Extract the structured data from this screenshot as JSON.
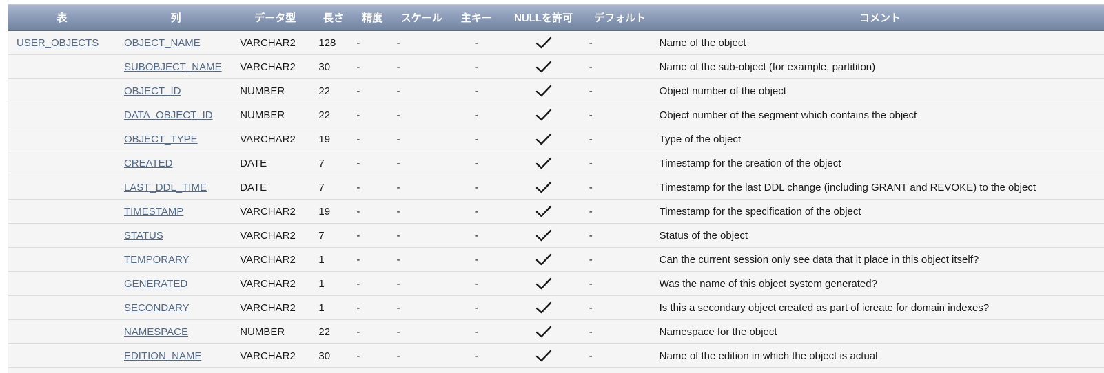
{
  "headers": {
    "table": "表",
    "column": "列",
    "data_type": "データ型",
    "length": "長さ",
    "precision": "精度",
    "scale": "スケール",
    "primary_key": "主キー",
    "nullable": "NULLを許可",
    "default": "デフォルト",
    "comment": "コメント"
  },
  "table_name": "USER_OBJECTS",
  "rows": [
    {
      "column": "OBJECT_NAME",
      "type": "VARCHAR2",
      "length": "128",
      "precision": "-",
      "scale": "-",
      "pk": "-",
      "nullable": true,
      "default": "-",
      "comment": "Name of the object"
    },
    {
      "column": "SUBOBJECT_NAME",
      "type": "VARCHAR2",
      "length": "30",
      "precision": "-",
      "scale": "-",
      "pk": "-",
      "nullable": true,
      "default": "-",
      "comment": "Name of the sub-object (for example, partititon)"
    },
    {
      "column": "OBJECT_ID",
      "type": "NUMBER",
      "length": "22",
      "precision": "-",
      "scale": "-",
      "pk": "-",
      "nullable": true,
      "default": "-",
      "comment": "Object number of the object"
    },
    {
      "column": "DATA_OBJECT_ID",
      "type": "NUMBER",
      "length": "22",
      "precision": "-",
      "scale": "-",
      "pk": "-",
      "nullable": true,
      "default": "-",
      "comment": "Object number of the segment which contains the object"
    },
    {
      "column": "OBJECT_TYPE",
      "type": "VARCHAR2",
      "length": "19",
      "precision": "-",
      "scale": "-",
      "pk": "-",
      "nullable": true,
      "default": "-",
      "comment": "Type of the object"
    },
    {
      "column": "CREATED",
      "type": "DATE",
      "length": "7",
      "precision": "-",
      "scale": "-",
      "pk": "-",
      "nullable": true,
      "default": "-",
      "comment": "Timestamp for the creation of the object"
    },
    {
      "column": "LAST_DDL_TIME",
      "type": "DATE",
      "length": "7",
      "precision": "-",
      "scale": "-",
      "pk": "-",
      "nullable": true,
      "default": "-",
      "comment": "Timestamp for the last DDL change (including GRANT and REVOKE) to the object"
    },
    {
      "column": "TIMESTAMP",
      "type": "VARCHAR2",
      "length": "19",
      "precision": "-",
      "scale": "-",
      "pk": "-",
      "nullable": true,
      "default": "-",
      "comment": "Timestamp for the specification of the object"
    },
    {
      "column": "STATUS",
      "type": "VARCHAR2",
      "length": "7",
      "precision": "-",
      "scale": "-",
      "pk": "-",
      "nullable": true,
      "default": "-",
      "comment": "Status of the object"
    },
    {
      "column": "TEMPORARY",
      "type": "VARCHAR2",
      "length": "1",
      "precision": "-",
      "scale": "-",
      "pk": "-",
      "nullable": true,
      "default": "-",
      "comment": "Can the current session only see data that it place in this object itself?"
    },
    {
      "column": "GENERATED",
      "type": "VARCHAR2",
      "length": "1",
      "precision": "-",
      "scale": "-",
      "pk": "-",
      "nullable": true,
      "default": "-",
      "comment": "Was the name of this object system generated?"
    },
    {
      "column": "SECONDARY",
      "type": "VARCHAR2",
      "length": "1",
      "precision": "-",
      "scale": "-",
      "pk": "-",
      "nullable": true,
      "default": "-",
      "comment": "Is this a secondary object created as part of icreate for domain indexes?"
    },
    {
      "column": "NAMESPACE",
      "type": "NUMBER",
      "length": "22",
      "precision": "-",
      "scale": "-",
      "pk": "-",
      "nullable": true,
      "default": "-",
      "comment": "Namespace for the object"
    },
    {
      "column": "EDITION_NAME",
      "type": "VARCHAR2",
      "length": "30",
      "precision": "-",
      "scale": "-",
      "pk": "-",
      "nullable": true,
      "default": "-",
      "comment": "Name of the edition in which the object is actual"
    }
  ],
  "colors": {
    "header_top": "#aab7cd",
    "header_bottom": "#73849f",
    "link": "#536a88",
    "row_bg": "#f5f5f5",
    "row_border": "#dcdcdc"
  },
  "icons": {
    "nullable": "checkmark-icon"
  }
}
